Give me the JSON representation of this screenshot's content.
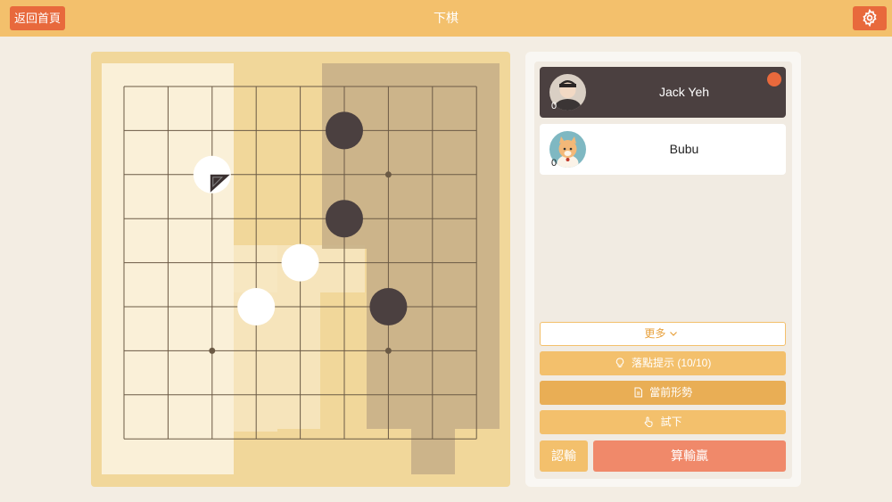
{
  "header": {
    "back_label": "返回首頁",
    "title": "下棋",
    "settings_icon": "gear-icon"
  },
  "board": {
    "size": 9,
    "star_points": [
      [
        6,
        2
      ],
      [
        2,
        6
      ],
      [
        6,
        6
      ]
    ],
    "stones": [
      {
        "col": 5,
        "row": 1,
        "color": "black"
      },
      {
        "col": 2,
        "row": 2,
        "color": "white",
        "last_move": true
      },
      {
        "col": 5,
        "row": 3,
        "color": "black"
      },
      {
        "col": 4,
        "row": 4,
        "color": "white"
      },
      {
        "col": 3,
        "row": 5,
        "color": "white"
      },
      {
        "col": 6,
        "row": 5,
        "color": "black"
      }
    ]
  },
  "players": [
    {
      "name": "Jack Yeh",
      "score": "0",
      "active": true
    },
    {
      "name": "Bubu",
      "score": "0",
      "active": false
    }
  ],
  "actions": {
    "more_label": "更多",
    "hint_label": "落點提示 (10/10)",
    "status_label": "當前形勢",
    "try_label": "試下",
    "resign_label": "認輸",
    "score_label": "算輸贏"
  },
  "colors": {
    "accent": "#e8693c",
    "header": "#f3c06c",
    "board": "#f1d79a",
    "black_stone": "#4b4040",
    "white_stone": "#ffffff"
  }
}
